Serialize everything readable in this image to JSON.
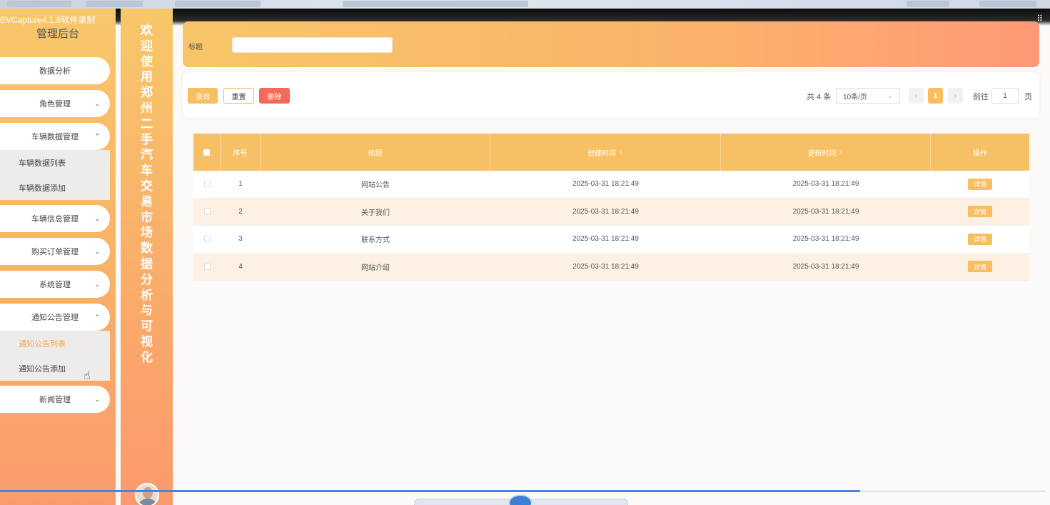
{
  "recorder": {
    "label": "EVCapture4.1.8软件录制"
  },
  "sidebar": {
    "title": "管理后台",
    "items": [
      {
        "label": "数据分析",
        "chevron": ""
      },
      {
        "label": "角色管理",
        "chevron": "⌄"
      },
      {
        "label": "车辆数据管理",
        "chevron": "⌃"
      },
      {
        "label": "车辆信息管理",
        "chevron": "⌄"
      },
      {
        "label": "购买订单管理",
        "chevron": "⌄"
      },
      {
        "label": "系统管理",
        "chevron": "⌄"
      },
      {
        "label": "通知公告管理",
        "chevron": "⌃"
      },
      {
        "label": "新闻管理",
        "chevron": "⌄"
      }
    ],
    "vehicle_data_sub": [
      "车辆数据列表",
      "车辆数据添加"
    ],
    "notice_sub": [
      "通知公告列表",
      "通知公告添加"
    ]
  },
  "welcome": {
    "text": "欢迎使用郑州二手汽车交易市场数据分析与可视化"
  },
  "search": {
    "label": "标题",
    "value": ""
  },
  "toolbar": {
    "query_label": "查询",
    "reset_label": "重置",
    "delete_label": "删除"
  },
  "pager": {
    "total_text": "共 4 条",
    "page_size": "10条/页",
    "prev": "‹",
    "current": "1",
    "next": "›",
    "goto_label": "前往",
    "goto_value": "1",
    "goto_suffix": "页"
  },
  "table": {
    "headers": [
      "序号",
      "标题",
      "创建时间",
      "更新时间",
      "操作"
    ],
    "sort_icon": "⇳",
    "rows": [
      {
        "index": "1",
        "title": "网站公告",
        "created": "2025-03-31 18:21:49",
        "updated": "2025-03-31 18:21:49",
        "action": "详情"
      },
      {
        "index": "2",
        "title": "关于我们",
        "created": "2025-03-31 18:21:49",
        "updated": "2025-03-31 18:21:49",
        "action": "详情"
      },
      {
        "index": "3",
        "title": "联系方式",
        "created": "2025-03-31 18:21:49",
        "updated": "2025-03-31 18:21:49",
        "action": "详情"
      },
      {
        "index": "4",
        "title": "网站介绍",
        "created": "2025-03-31 18:21:49",
        "updated": "2025-03-31 18:21:49",
        "action": "详情"
      }
    ]
  },
  "colors": {
    "accent": "#f7bf61",
    "danger": "#f46a5a",
    "active_text": "#f2a64a"
  },
  "icons": {
    "corner": "grid-icon",
    "cursor": "hand-pointer-icon"
  }
}
